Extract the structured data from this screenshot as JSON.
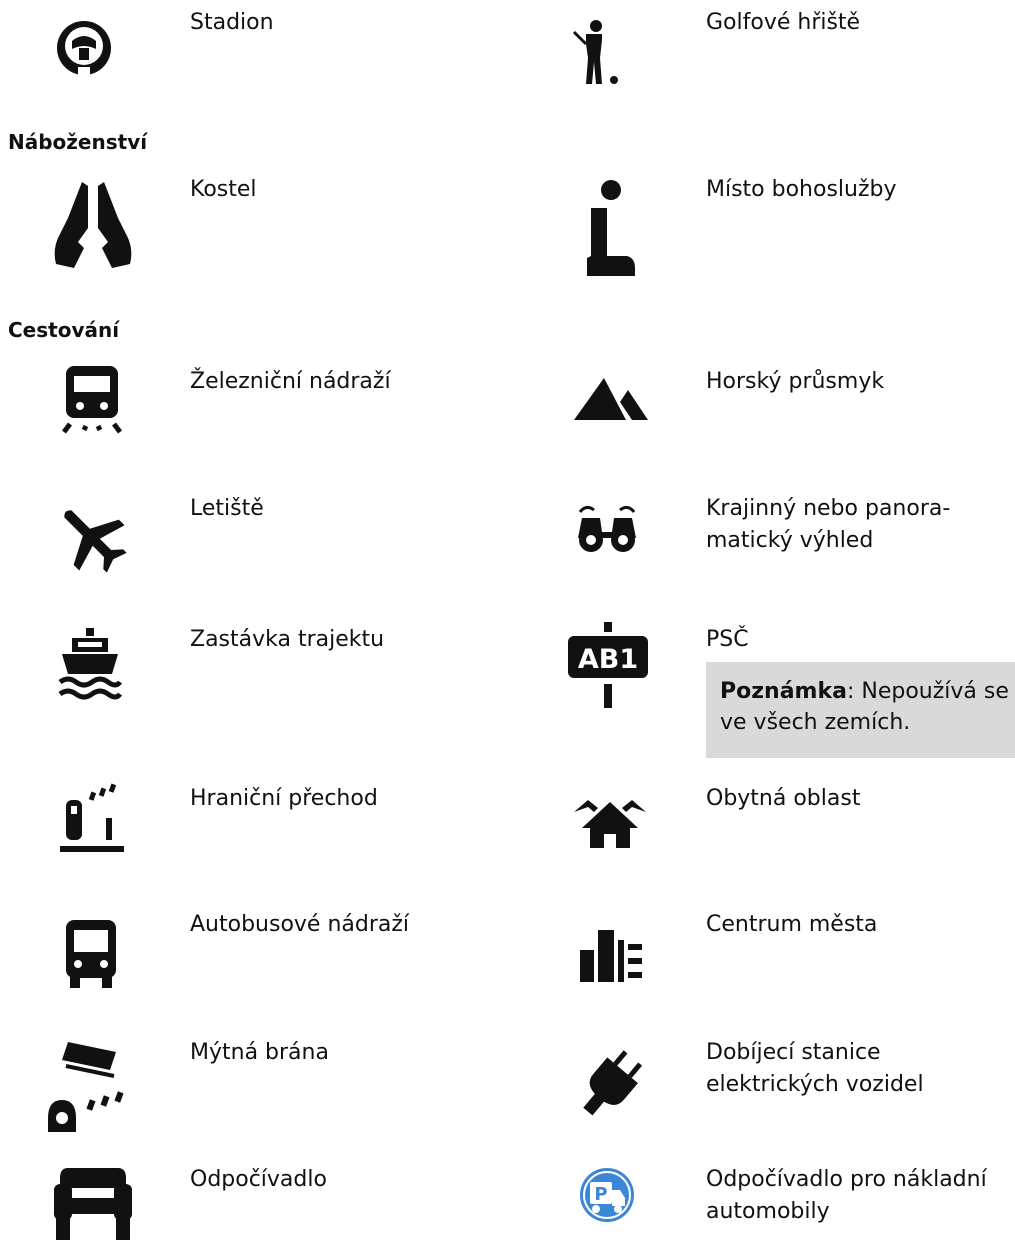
{
  "sections": {
    "religion": "Náboženství",
    "travel": "Cestování"
  },
  "items": {
    "stadium": "Stadion",
    "golf": "Golfové hřiště",
    "church": "Kostel",
    "worship": "Místo bohoslužby",
    "railway": "Železniční nádraží",
    "mountain_pass": "Horský průsmyk",
    "airport": "Letiště",
    "scenic_line1": "Krajinný nebo panora-",
    "scenic_line2": "matický výhled",
    "ferry": "Zastávka trajektu",
    "postcode": "PSČ",
    "border": "Hraniční přechod",
    "residential": "Obytná oblast",
    "bus": "Autobusové nádraží",
    "city_centre": "Centrum města",
    "toll": "Mýtná brána",
    "ev_line1": "Dobíjecí stanice",
    "ev_line2": "elektrických vozidel",
    "rest_area": "Odpočívadlo",
    "truck_rest_line1": "Odpočívadlo pro nákladní",
    "truck_rest_line2": "automobily"
  },
  "note": {
    "label": "Poznámka",
    "colon": ": ",
    "text_line1": "Nepoužívá se",
    "text_line2": "ve všech zemích."
  },
  "postcode_sign_text": "AB1",
  "truck_rest_badge_letter": "P",
  "colors": {
    "icon": "#111111",
    "note_background": "#d9d9d9",
    "truck_badge": "#3b86d6"
  }
}
